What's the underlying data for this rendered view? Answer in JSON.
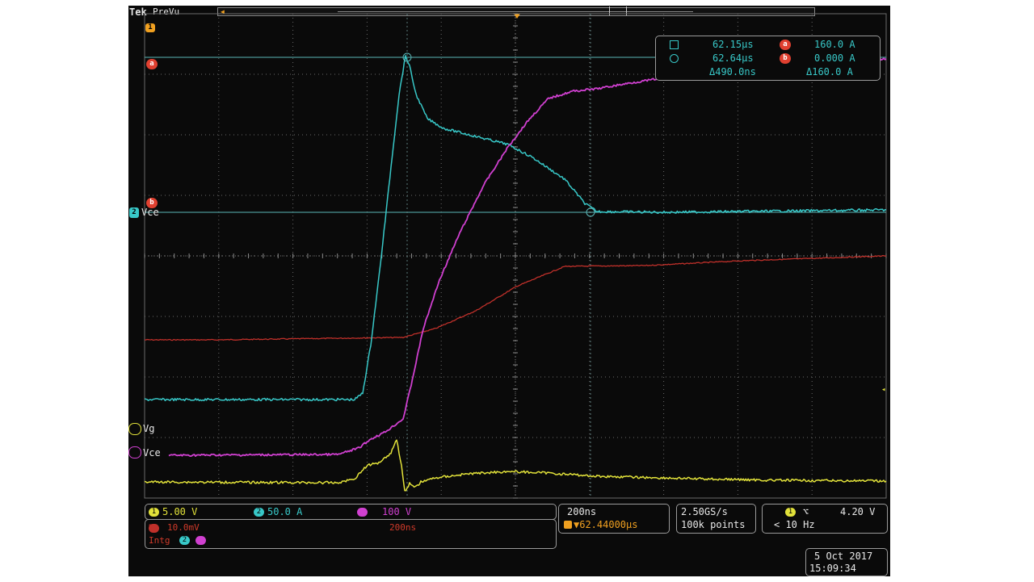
{
  "header": {
    "brand": "Tek",
    "mode": "PreVu"
  },
  "waveform_labels": {
    "vce_ch2": "Vce",
    "vg": "Vg",
    "vce_math": "Vce",
    "ch2_marker": "2",
    "cursor_a": "a",
    "cursor_b": "b",
    "ch1_top": "1"
  },
  "cursor_readout": {
    "a_time": "62.15µs",
    "b_time": "62.64µs",
    "delta_time": "Δ490.0ns",
    "a_value": "160.0 A",
    "b_value": "0.000 A",
    "delta_value": "Δ160.0 A",
    "a_marker": "a",
    "b_marker": "b"
  },
  "channels": {
    "ch1": {
      "num": "1",
      "scale": "5.00 V"
    },
    "ch2": {
      "num": "2",
      "scale": "50.0 A"
    },
    "ch3": {
      "num": "3",
      "scale": "100 V"
    },
    "ref": {
      "num": "R",
      "scale": "10.0mV",
      "time": "200ns"
    },
    "trig_label": "Intg",
    "trig_num_a": "2",
    "trig_num_b": "3"
  },
  "timebase": {
    "scale": "200ns",
    "position": "▼62.44000µs"
  },
  "acquisition": {
    "rate": "2.50GS/s",
    "points": "100k points"
  },
  "trigger": {
    "source": "1",
    "slope": "⌥",
    "level": "4.20 V",
    "freq": "< 10 Hz"
  },
  "datetime": {
    "date": "5 Oct  2017",
    "time": "15:09:34"
  },
  "colors": {
    "ch1": "#e2e23a",
    "ch2": "#38c8c8",
    "ch3": "#d040d0",
    "ref": "#c0302a",
    "grid": "#6a6a6a"
  }
}
